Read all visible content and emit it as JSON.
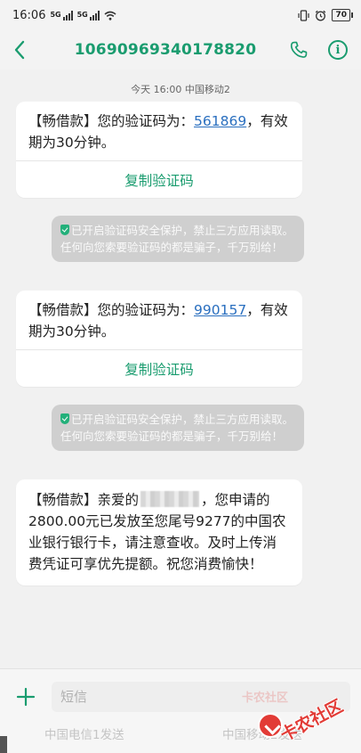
{
  "status_bar": {
    "time": "16:06",
    "signal_1": "5G",
    "signal_2": "5G",
    "battery": "70"
  },
  "header": {
    "phone_number": "10690969340178820"
  },
  "chat": {
    "timestamp": "今天 16:00  中国移动2",
    "messages": [
      {
        "text_before": "【畅借款】您的验证码为：",
        "code": "561869",
        "text_after": "，有效期为30分钟。",
        "copy_label": "复制验证码"
      },
      {
        "text_before": "【畅借款】您的验证码为：",
        "code": "990157",
        "text_after": "，有效期为30分钟。",
        "copy_label": "复制验证码"
      }
    ],
    "security_notice": "已开启验证码安全保护，禁止三方应用读取。任何向您索要验证码的都是骗子，千万别给！",
    "last_message": {
      "prefix": "【畅借款】亲爱的",
      "suffix": "，您申请的2800.00元已发放至您尾号9277的中国农业银行银行卡，请注意查收。及时上传消费凭证可享优先提额。祝您消费愉快！"
    }
  },
  "input_bar": {
    "placeholder": "短信",
    "send_sim1": "中国电信1发送",
    "send_sim2": "中国移动2发送"
  },
  "watermark": {
    "text": "卡农社区",
    "faint_text": "卡农社区"
  },
  "colors": {
    "accent": "#1a9c6f",
    "link": "#2a6fbf",
    "notice_bg": "#cfcfcf",
    "watermark": "#e23b36"
  }
}
